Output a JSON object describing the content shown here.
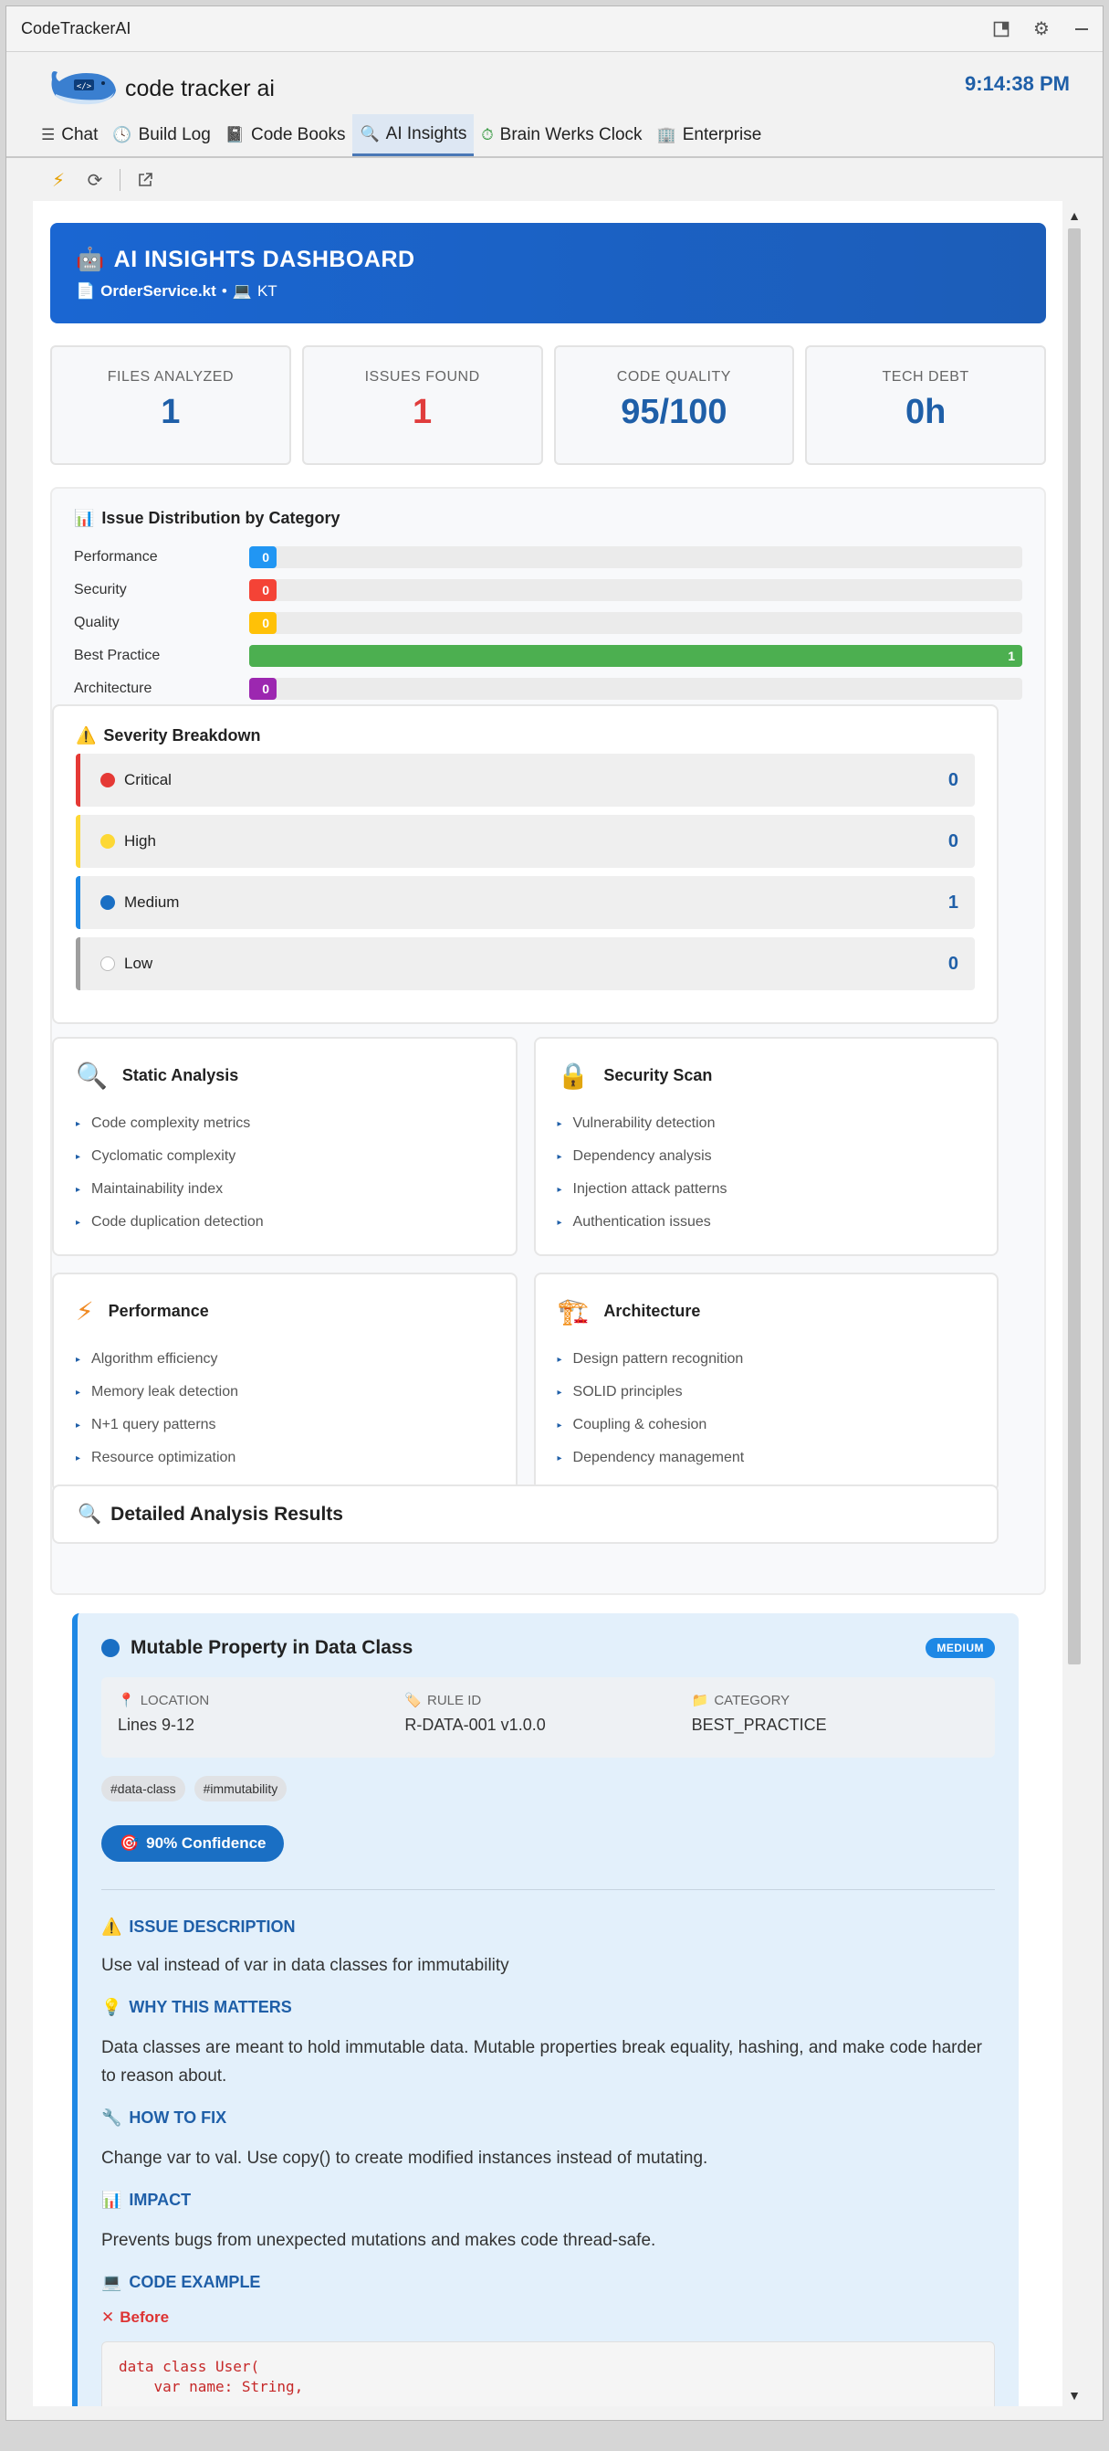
{
  "window": {
    "title": "CodeTrackerAI"
  },
  "header": {
    "logo_text": "code tracker ai",
    "clock": "9:14:38 PM"
  },
  "tabs": [
    {
      "label": "Chat",
      "icon": "menu-icon"
    },
    {
      "label": "Build Log",
      "icon": "clock-icon"
    },
    {
      "label": "Code Books",
      "icon": "book-icon"
    },
    {
      "label": "AI Insights",
      "icon": "search-icon"
    },
    {
      "label": "Brain Werks Clock",
      "icon": "timer-icon"
    },
    {
      "label": "Enterprise",
      "icon": "building-icon"
    }
  ],
  "dashboard": {
    "title": "AI INSIGHTS DASHBOARD",
    "file": "OrderService.kt",
    "separator": "•",
    "lang": "KT"
  },
  "stats": [
    {
      "label": "FILES ANALYZED",
      "value": "1"
    },
    {
      "label": "ISSUES FOUND",
      "value": "1"
    },
    {
      "label": "CODE QUALITY",
      "value": "95/100"
    },
    {
      "label": "TECH DEBT",
      "value": "0h"
    }
  ],
  "distribution": {
    "title": "Issue Distribution by Category",
    "rows": [
      {
        "label": "Performance",
        "value": 0,
        "fraction": 0,
        "color": "#2196f3"
      },
      {
        "label": "Security",
        "value": 0,
        "fraction": 0,
        "color": "#f44336"
      },
      {
        "label": "Quality",
        "value": 0,
        "fraction": 0,
        "color": "#ffc107"
      },
      {
        "label": "Best Practice",
        "value": 1,
        "fraction": 1,
        "color": "#4caf50"
      },
      {
        "label": "Architecture",
        "value": 0,
        "fraction": 0,
        "color": "#9c27b0"
      }
    ]
  },
  "severity": {
    "title": "Severity Breakdown",
    "rows": [
      {
        "label": "Critical",
        "count": "0",
        "color": "#e53935"
      },
      {
        "label": "High",
        "count": "0",
        "color": "#fdd835"
      },
      {
        "label": "Medium",
        "count": "1",
        "color": "#1e88e5"
      },
      {
        "label": "Low",
        "count": "0",
        "color": "#9e9e9e"
      }
    ]
  },
  "cards": [
    {
      "title": "Static Analysis",
      "icon": "magnifier-icon",
      "items": [
        "Code complexity metrics",
        "Cyclomatic complexity",
        "Maintainability index",
        "Code duplication detection"
      ]
    },
    {
      "title": "Security Scan",
      "icon": "lock-icon",
      "items": [
        "Vulnerability detection",
        "Dependency analysis",
        "Injection attack patterns",
        "Authentication issues"
      ]
    },
    {
      "title": "Performance",
      "icon": "lightning-icon",
      "items": [
        "Algorithm efficiency",
        "Memory leak detection",
        "N+1 query patterns",
        "Resource optimization"
      ]
    },
    {
      "title": "Architecture",
      "icon": "crane-icon",
      "items": [
        "Design pattern recognition",
        "SOLID principles",
        "Coupling & cohesion",
        "Dependency management"
      ]
    }
  ],
  "detailed": {
    "title": "Detailed Analysis Results"
  },
  "issue": {
    "title": "Mutable Property in Data Class",
    "badge": "MEDIUM",
    "location_label": "LOCATION",
    "location": "Lines 9-12",
    "rule_label": "RULE ID",
    "rule": "R-DATA-001 v1.0.0",
    "category_label": "CATEGORY",
    "category": "BEST_PRACTICE",
    "tags": [
      "#data-class",
      "#immutability"
    ],
    "confidence": "90% Confidence",
    "desc_title": "ISSUE DESCRIPTION",
    "desc": "Use val instead of var in data classes for immutability",
    "why_title": "WHY THIS MATTERS",
    "why": "Data classes are meant to hold immutable data. Mutable properties break equality, hashing, and make code harder to reason about.",
    "fix_title": "HOW TO FIX",
    "fix": "Change var to val. Use copy() to create modified instances instead of mutating.",
    "impact_title": "IMPACT",
    "impact": "Prevents bugs from unexpected mutations and makes code thread-safe.",
    "example_title": "CODE EXAMPLE",
    "before_label": "Before",
    "code": "data class User(\n    var name: String,"
  }
}
